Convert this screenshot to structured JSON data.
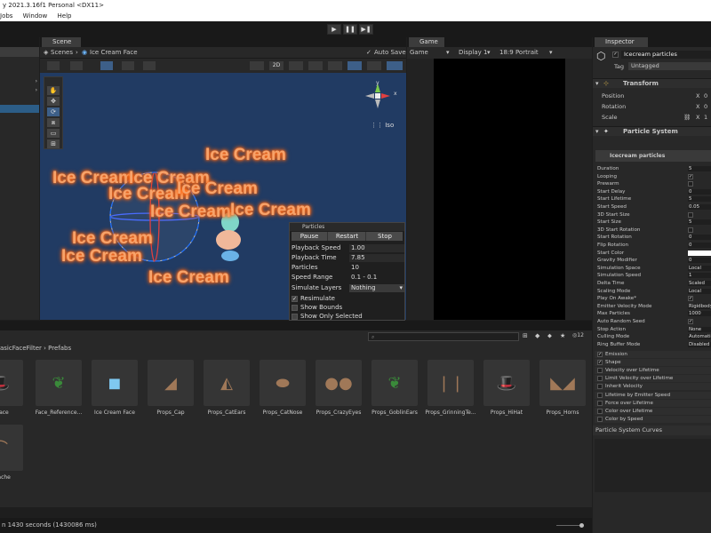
{
  "window": {
    "title": "y 2021.3.16f1 Personal <DX11>"
  },
  "menu": {
    "items": [
      "Jobs",
      "Window",
      "Help"
    ]
  },
  "toolbar": {
    "play": "▶",
    "pause": "❚❚",
    "step": "▶❚"
  },
  "scene": {
    "tab_label": "Scene",
    "breadcrumb_root": "Scenes",
    "breadcrumb_current": "Ice Cream Face",
    "auto_save_label": "Auto Save",
    "mode_2d": "2D",
    "gizmo_axes": {
      "y": "y",
      "x": "x"
    },
    "gizmo_projection": "Iso",
    "particle_text": "Ice Cream"
  },
  "particles_panel": {
    "title": "Particles",
    "buttons": {
      "pause": "Pause",
      "restart": "Restart",
      "stop": "Stop"
    },
    "fields": {
      "playback_speed": {
        "label": "Playback Speed",
        "value": "1.00"
      },
      "playback_time": {
        "label": "Playback Time",
        "value": "7.85"
      },
      "particles": {
        "label": "Particles",
        "value": "10"
      },
      "speed_range": {
        "label": "Speed Range",
        "value": "0.1 - 0.1"
      },
      "simulate_layers": {
        "label": "Simulate Layers",
        "value": "Nothing"
      }
    },
    "toggles": {
      "resimulate": "Resimulate",
      "show_bounds": "Show Bounds",
      "show_only_selected": "Show Only Selected"
    }
  },
  "game": {
    "tab_label": "Game",
    "mode": "Game",
    "display": "Display 1",
    "aspect": "18:9 Portrait"
  },
  "inspector": {
    "tab_label": "Inspector",
    "object_name": "Icecream particles",
    "tag_label": "Tag",
    "tag_value": "Untagged",
    "transform_title": "Transform",
    "transform_rows": [
      "Position",
      "Rotation",
      "Scale"
    ],
    "transform_values": [
      {
        "axis": "X",
        "value": "0"
      },
      {
        "axis": "X",
        "value": "0"
      },
      {
        "axis": "X",
        "value": "1"
      }
    ],
    "ps_title": "Particle System",
    "ps_name": "Icecream particles",
    "ps_rows": [
      {
        "label": "Duration",
        "value": "5",
        "kind": "value"
      },
      {
        "label": "Looping",
        "value": "✓",
        "kind": "check"
      },
      {
        "label": "Prewarm",
        "value": "",
        "kind": "check"
      },
      {
        "label": "Start Delay",
        "value": "0",
        "kind": "value"
      },
      {
        "label": "Start Lifetime",
        "value": "5",
        "kind": "value"
      },
      {
        "label": "Start Speed",
        "value": "0.05",
        "kind": "value"
      },
      {
        "label": "3D Start Size",
        "value": "",
        "kind": "check"
      },
      {
        "label": "Start Size",
        "value": "5",
        "kind": "value"
      },
      {
        "label": "3D Start Rotation",
        "value": "",
        "kind": "check"
      },
      {
        "label": "Start Rotation",
        "value": "0",
        "kind": "value"
      },
      {
        "label": "Flip Rotation",
        "value": "0",
        "kind": "value"
      },
      {
        "label": "Start Color",
        "value": "",
        "kind": "color"
      },
      {
        "label": "Gravity Modifier",
        "value": "0",
        "kind": "value"
      },
      {
        "label": "Simulation Space",
        "value": "Local",
        "kind": "value"
      },
      {
        "label": "Simulation Speed",
        "value": "1",
        "kind": "value"
      },
      {
        "label": "Delta Time",
        "value": "Scaled",
        "kind": "value"
      },
      {
        "label": "Scaling Mode",
        "value": "Local",
        "kind": "value"
      },
      {
        "label": "Play On Awake*",
        "value": "✓",
        "kind": "check"
      },
      {
        "label": "Emitter Velocity Mode",
        "value": "Rigidbody",
        "kind": "value"
      },
      {
        "label": "Max Particles",
        "value": "1000",
        "kind": "value"
      },
      {
        "label": "Auto Random Seed",
        "value": "✓",
        "kind": "check"
      },
      {
        "label": "Stop Action",
        "value": "None",
        "kind": "value"
      },
      {
        "label": "Culling Mode",
        "value": "Automatic",
        "kind": "value"
      },
      {
        "label": "Ring Buffer Mode",
        "value": "Disabled",
        "kind": "value"
      }
    ],
    "modules": [
      {
        "label": "Emission",
        "checked": "✓"
      },
      {
        "label": "Shape",
        "checked": "✓"
      },
      {
        "label": "Velocity over Lifetime",
        "checked": ""
      },
      {
        "label": "Limit Velocity over Lifetime",
        "checked": ""
      },
      {
        "label": "Inherit Velocity",
        "checked": ""
      },
      {
        "label": "Lifetime by Emitter Speed",
        "checked": ""
      },
      {
        "label": "Force over Lifetime",
        "checked": ""
      },
      {
        "label": "Color over Lifetime",
        "checked": ""
      },
      {
        "label": "Color by Speed",
        "checked": ""
      }
    ],
    "curves_title": "Particle System Curves"
  },
  "project": {
    "breadcrumb_root": "asicFaceFilter",
    "breadcrumb_current": "Prefabs",
    "counter": "12",
    "assets": [
      "lt Face",
      "Face_Reference...",
      "Ice Cream Face",
      "Props_Cap",
      "Props_CatEars",
      "Props_CatNose",
      "Props_CrazyEyes",
      "Props_GoblinEars",
      "Props_GrinningTe...",
      "Props_HiHat",
      "Props_Horns",
      "ustache"
    ]
  },
  "status": {
    "text": "n 1430 seconds (1430086 ms)"
  },
  "colors": {
    "accent": "#2c5d87",
    "particle_text": "#f7a36a",
    "scene_bg": "#213b63"
  }
}
